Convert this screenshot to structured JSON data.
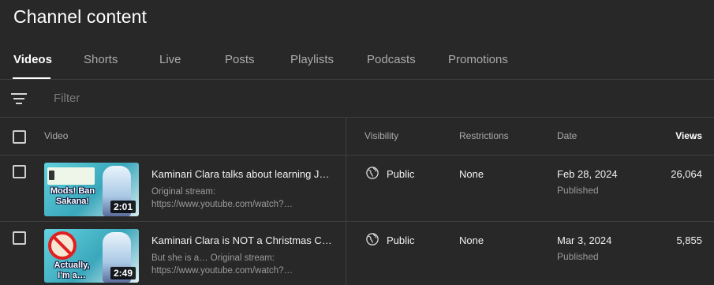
{
  "page": {
    "title": "Channel content"
  },
  "tabs": [
    {
      "label": "Videos",
      "active": true
    },
    {
      "label": "Shorts"
    },
    {
      "label": "Live"
    },
    {
      "label": "Posts"
    },
    {
      "label": "Playlists"
    },
    {
      "label": "Podcasts"
    },
    {
      "label": "Promotions"
    }
  ],
  "filter": {
    "placeholder": "Filter",
    "icon": "filter-icon"
  },
  "table": {
    "headers": {
      "video": "Video",
      "visibility": "Visibility",
      "restrictions": "Restrictions",
      "date": "Date",
      "views": "Views",
      "sort_indicator": "↓"
    },
    "rows": [
      {
        "thumbnail_text": "Mods! Ban Sakana!",
        "duration": "2:01",
        "title": "Kaminari Clara talks about learning Ja…",
        "desc_line1": "Original stream:",
        "desc_line2": "https://www.youtube.com/watch?…",
        "visibility": "Public",
        "restrictions": "None",
        "date": "Feb 28, 2024",
        "date_status": "Published",
        "views": "26,064"
      },
      {
        "thumbnail_text": "Actually, I'm a…",
        "duration": "2:49",
        "title": "Kaminari Clara is NOT a Christmas Ca…",
        "desc_line1": "But she is a… Original stream:",
        "desc_line2": "https://www.youtube.com/watch?…",
        "visibility": "Public",
        "restrictions": "None",
        "date": "Mar 3, 2024",
        "date_status": "Published",
        "views": "5,855"
      }
    ]
  },
  "colors": {
    "background": "#282828",
    "divider": "#3e3e3e",
    "muted_text": "#aaaaaa",
    "thumb_accent": "#4ab9c9"
  }
}
